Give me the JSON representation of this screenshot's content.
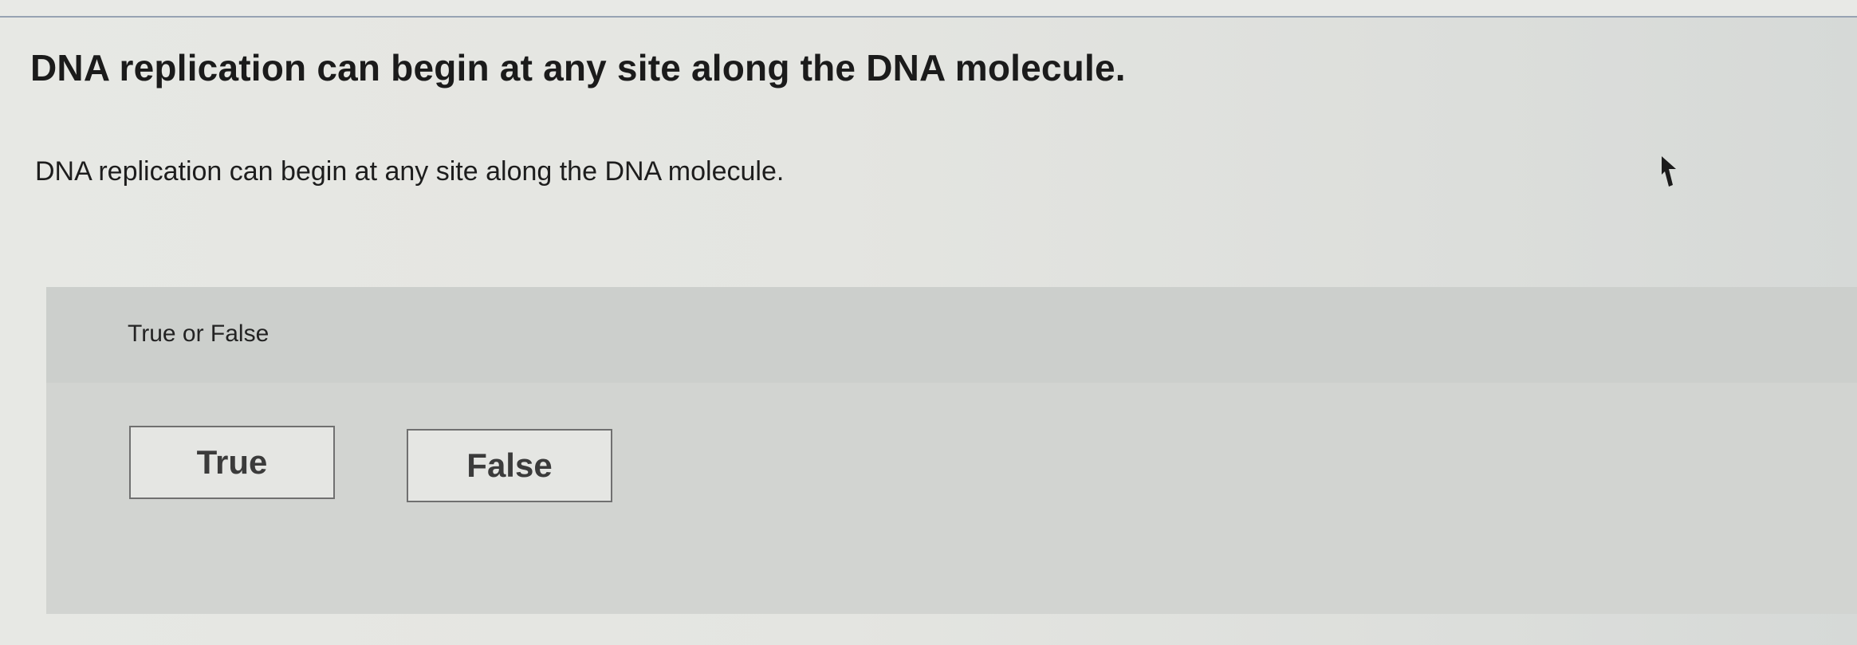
{
  "question": {
    "title": "DNA replication can begin at any site along the DNA molecule.",
    "prompt": "DNA replication can begin at any site along the DNA molecule."
  },
  "answer_panel": {
    "label": "True or False",
    "choices": [
      {
        "label": "True"
      },
      {
        "label": "False"
      }
    ]
  }
}
